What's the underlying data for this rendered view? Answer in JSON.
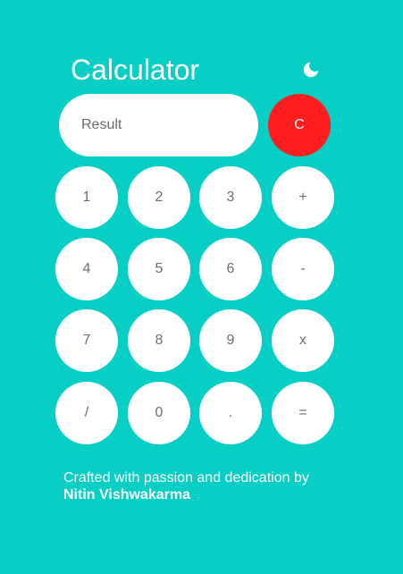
{
  "app": {
    "title": "Calculator",
    "theme_icon": "moon-icon"
  },
  "display": {
    "placeholder": "Result",
    "value": ""
  },
  "clear_button": {
    "label": "C",
    "color": "#ff1d1d"
  },
  "keys": [
    [
      "1",
      "2",
      "3",
      "+"
    ],
    [
      "4",
      "5",
      "6",
      "-"
    ],
    [
      "7",
      "8",
      "9",
      "x"
    ],
    [
      "/",
      "0",
      ".",
      "="
    ]
  ],
  "footer": {
    "text": "Crafted with passion and dedication by",
    "author": "Nitin Vishwakarma"
  },
  "colors": {
    "background": "#08cfc6",
    "key_background": "#ffffff",
    "key_text": "#6e6e6e"
  }
}
